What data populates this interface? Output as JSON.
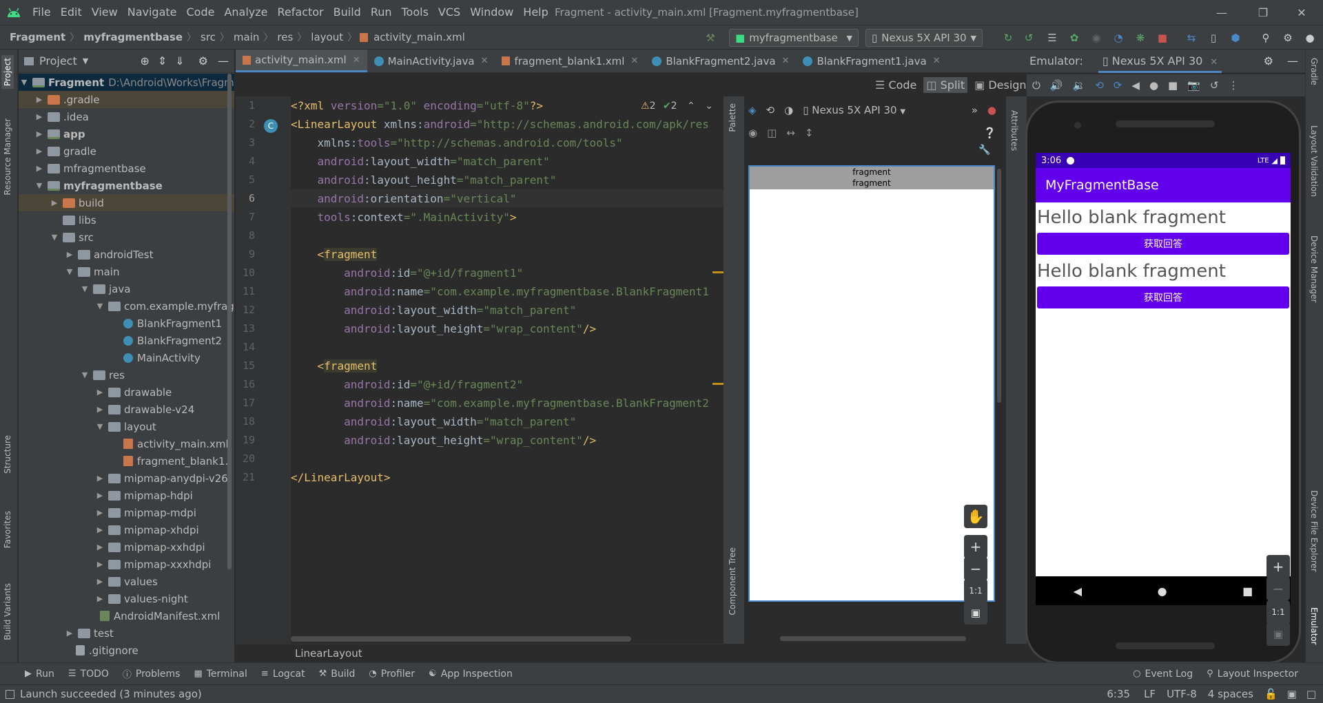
{
  "menu": {
    "items": [
      "File",
      "Edit",
      "View",
      "Navigate",
      "Code",
      "Analyze",
      "Refactor",
      "Build",
      "Run",
      "Tools",
      "VCS",
      "Window",
      "Help"
    ],
    "window_title": "Fragment - activity_main.xml [Fragment.myfragmentbase]"
  },
  "nav": {
    "crumbs": [
      "Fragment",
      "myfragmentbase",
      "src",
      "main",
      "res",
      "layout",
      "activity_main.xml"
    ],
    "run_config": "myfragmentbase",
    "device": "Nexus 5X API 30"
  },
  "project": {
    "title": "Project",
    "root_name": "Fragment",
    "root_path": "D:\\Android\\Works\\Fragm",
    "tree": [
      ".gradle",
      ".idea",
      "app",
      "gradle",
      "mfragmentbase",
      "myfragmentbase",
      "build",
      "libs",
      "src",
      "androidTest",
      "main",
      "java",
      "com.example.myfrag",
      "BlankFragment1",
      "BlankFragment2",
      "MainActivity",
      "res",
      "drawable",
      "drawable-v24",
      "layout",
      "activity_main.xml",
      "fragment_blank1.",
      "mipmap-anydpi-v26",
      "mipmap-hdpi",
      "mipmap-mdpi",
      "mipmap-xhdpi",
      "mipmap-xxhdpi",
      "mipmap-xxxhdpi",
      "values",
      "values-night",
      "AndroidManifest.xml",
      "test",
      ".gitignore"
    ]
  },
  "left_tabs": [
    "Project",
    "Resource Manager",
    "Structure",
    "Favorites",
    "Build Variants"
  ],
  "right_tabs": [
    "Gradle",
    "Layout Validation",
    "Device Manager",
    "Device File Explorer",
    "Emulator"
  ],
  "editor": {
    "tabs": [
      "activity_main.xml",
      "MainActivity.java",
      "fragment_blank1.xml",
      "BlankFragment2.java",
      "BlankFragment1.java"
    ],
    "view_modes": [
      "Code",
      "Split",
      "Design"
    ],
    "warnings": "2",
    "weak_warnings": "2",
    "line_numbers": [
      "1",
      "2",
      "3",
      "4",
      "5",
      "6",
      "7",
      "8",
      "9",
      "10",
      "11",
      "12",
      "13",
      "14",
      "15",
      "16",
      "17",
      "18",
      "19",
      "20",
      "21"
    ],
    "breadcrumb": "LinearLayout"
  },
  "design": {
    "palette_label": "Palette",
    "component_tree_label": "Component Tree",
    "attributes_label": "Attributes",
    "device": "Nexus 5X API 30",
    "fragment_labels": [
      "fragment",
      "fragment"
    ],
    "zoom_reset": "1:1"
  },
  "emulator": {
    "label": "Emulator:",
    "device": "Nexus 5X API 30",
    "time": "3:06",
    "network": "LTE",
    "app_title": "MyFragmentBase",
    "fragment_text_1": "Hello blank fragment",
    "button_1": "获取回答",
    "fragment_text_2": "Hello blank fragment",
    "button_2": "获取回答",
    "zoom_reset": "1:1"
  },
  "bottom_tools": [
    "Run",
    "TODO",
    "Problems",
    "Terminal",
    "Logcat",
    "Build",
    "Profiler",
    "App Inspection"
  ],
  "bottom_tools_right": [
    "Event Log",
    "Layout Inspector"
  ],
  "status": {
    "message": "Launch succeeded (3 minutes ago)",
    "position": "6:35",
    "line_sep": "LF",
    "encoding": "UTF-8",
    "indent": "4 spaces"
  },
  "colors": {
    "accent": "#4a88c7",
    "app_primary": "#6200ee",
    "app_status": "#3700b3"
  }
}
